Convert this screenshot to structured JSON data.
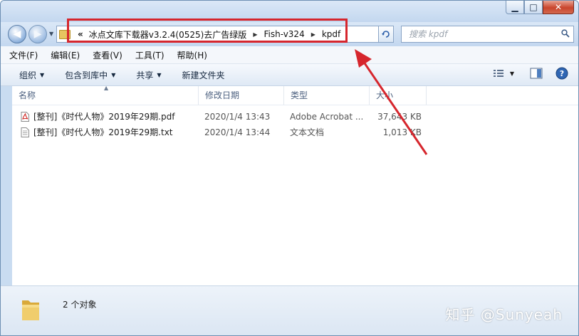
{
  "window": {
    "controls": {
      "minimize": "▁",
      "maximize": "□",
      "close": "✕"
    }
  },
  "nav": {
    "back_glyph": "◀",
    "forward_glyph": "▶",
    "breadcrumb_prefix": "«",
    "breadcrumbs": [
      "冰点文库下载器v3.2.4(0525)去广告绿版",
      "Fish-v324",
      "kpdf"
    ],
    "search_placeholder": "搜索 kpdf"
  },
  "menu": [
    "文件(F)",
    "编辑(E)",
    "查看(V)",
    "工具(T)",
    "帮助(H)"
  ],
  "toolbar": {
    "organize": "组织",
    "include_library": "包含到库中",
    "share": "共享",
    "new_folder": "新建文件夹"
  },
  "columns": {
    "name": "名称",
    "date": "修改日期",
    "type": "类型",
    "size": "大小"
  },
  "files": [
    {
      "name": "[整刊]《时代人物》2019年29期.pdf",
      "date": "2020/1/4 13:43",
      "type": "Adobe Acrobat ...",
      "size": "37,643 KB",
      "icon": "pdf-file-icon"
    },
    {
      "name": "[整刊]《时代人物》2019年29期.txt",
      "date": "2020/1/4 13:44",
      "type": "文本文档",
      "size": "1,013 KB",
      "icon": "text-file-icon"
    }
  ],
  "status": {
    "count": "2 个对象"
  },
  "watermark": "知乎 @Sunyeah",
  "colors": {
    "annotation_red": "#d6262d",
    "chrome_blue": "#c9dcf1"
  }
}
